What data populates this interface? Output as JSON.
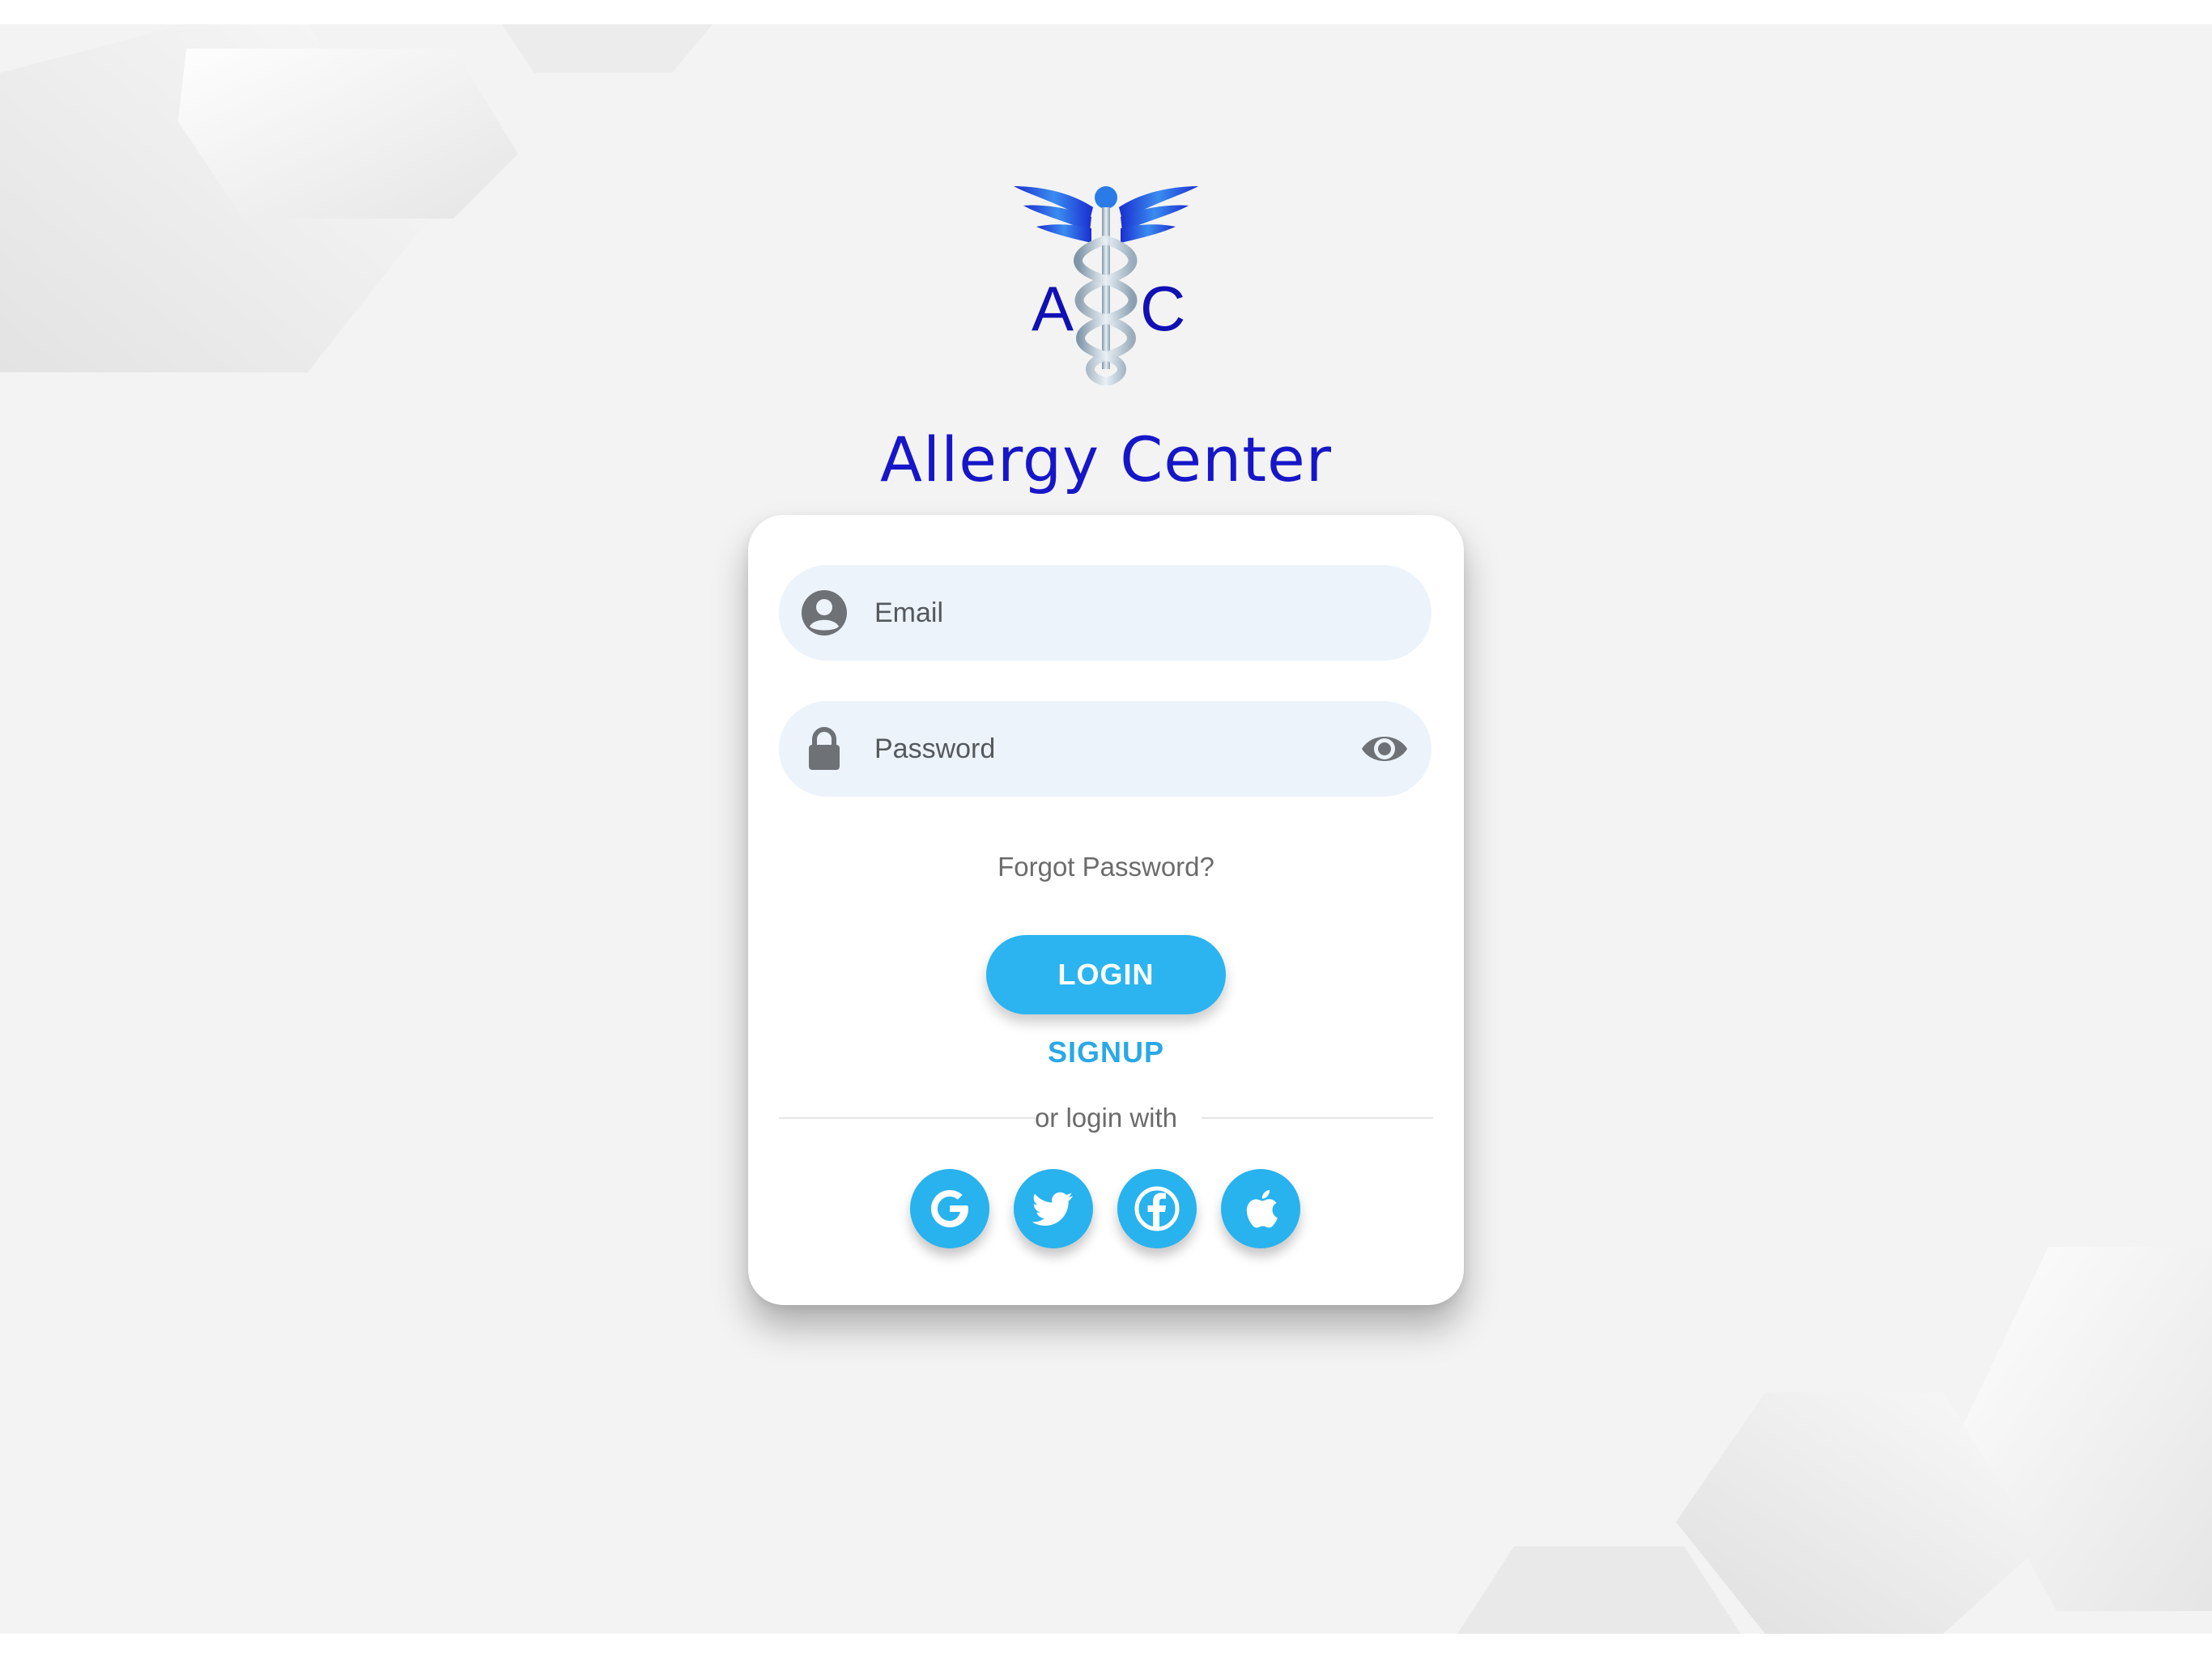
{
  "app": {
    "title": "Allergy Center",
    "logo_letters": "AC",
    "brand_color": "#1616c8",
    "accent_color": "#2bb4f0"
  },
  "form": {
    "email_placeholder": "Email",
    "password_placeholder": "Password",
    "forgot_label": "Forgot Password?",
    "login_label": "LOGIN",
    "signup_label": "SIGNUP",
    "divider_label": "or login with"
  },
  "social": [
    {
      "name": "google",
      "icon": "google-icon"
    },
    {
      "name": "twitter",
      "icon": "twitter-icon"
    },
    {
      "name": "facebook",
      "icon": "facebook-icon"
    },
    {
      "name": "apple",
      "icon": "apple-icon"
    }
  ],
  "icons": {
    "email_field": "user-circle-icon",
    "password_field": "lock-icon",
    "toggle_visibility": "eye-icon"
  }
}
